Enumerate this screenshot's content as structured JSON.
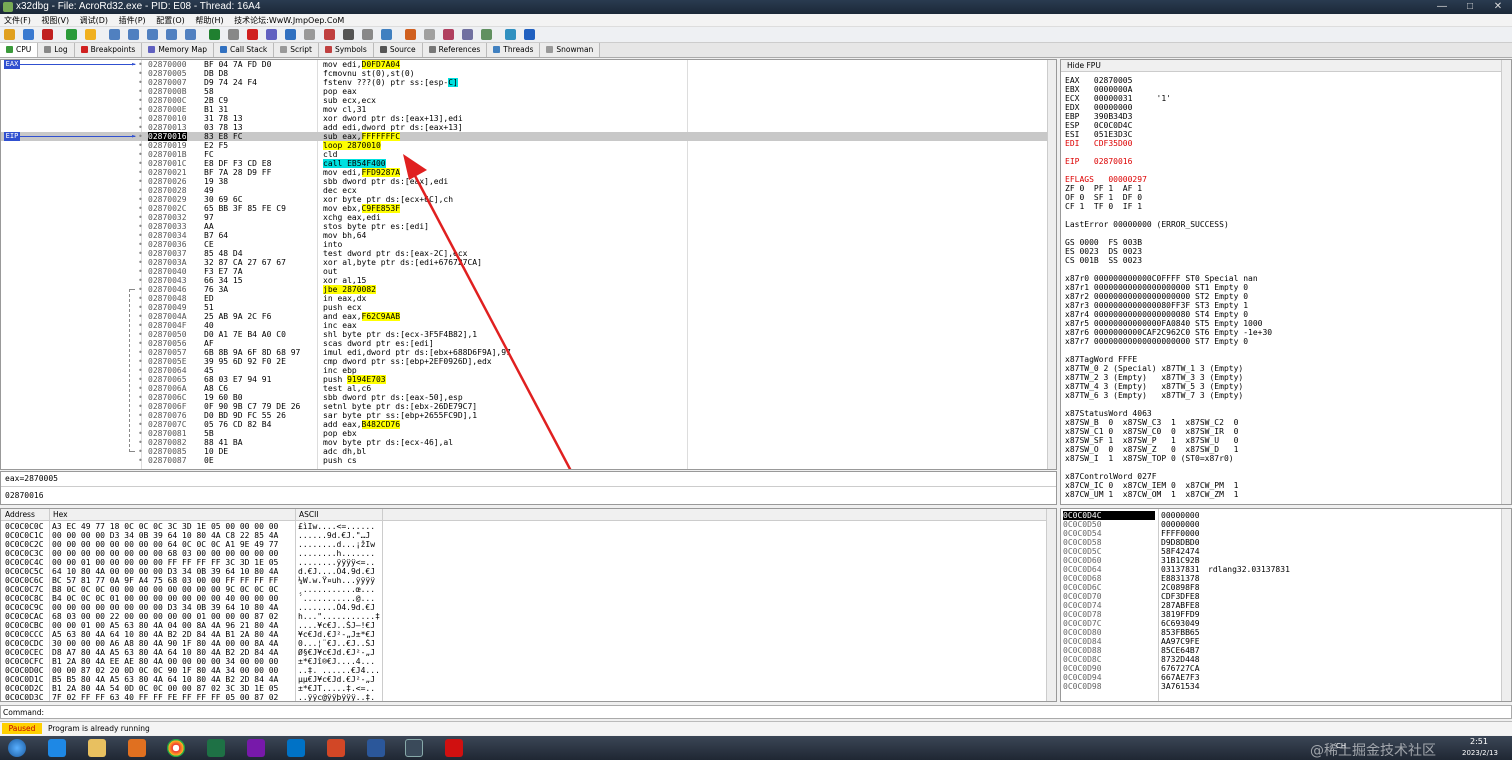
{
  "window": {
    "title": "x32dbg - File: AcroRd32.exe - PID: E08 - Thread: 16A4"
  },
  "menu": [
    "文件(F)",
    "视图(V)",
    "调试(D)",
    "插件(P)",
    "配置(O)",
    "帮助(H)",
    "技术论坛:WwW.JmpOep.CoM"
  ],
  "tabs": [
    {
      "label": "CPU",
      "color": "#3a9a3a"
    },
    {
      "label": "Log",
      "color": "#888"
    },
    {
      "label": "Breakpoints",
      "color": "#d02020"
    },
    {
      "label": "Memory Map",
      "color": "#6060c0"
    },
    {
      "label": "Call Stack",
      "color": "#3070c0"
    },
    {
      "label": "Script",
      "color": "#999"
    },
    {
      "label": "Symbols",
      "color": "#c04040"
    },
    {
      "label": "Source",
      "color": "#555"
    },
    {
      "label": "References",
      "color": "#777"
    },
    {
      "label": "Threads",
      "color": "#4080c0"
    },
    {
      "label": "Snowman",
      "color": "#999"
    }
  ],
  "disasm": {
    "eax_label": "EAX",
    "eip_label": "EIP",
    "rows": [
      {
        "addr": "02870000",
        "bytes": "BF 04 7A FD D0",
        "ins": "mov edi,",
        "op": "D0FD7A04",
        "opc": "hl"
      },
      {
        "addr": "02870005",
        "bytes": "DB D8",
        "ins": "fcmovnu st(0),st(0)"
      },
      {
        "addr": "02870007",
        "bytes": "D9 74 24 F4",
        "ins": "fstenv ???(0) ptr ss:[esp-",
        "op": "C]",
        "opc": "hlc"
      },
      {
        "addr": "0287000B",
        "bytes": "58",
        "ins": "pop eax"
      },
      {
        "addr": "0287000C",
        "bytes": "2B C9",
        "ins": "sub ecx,ecx"
      },
      {
        "addr": "0287000E",
        "bytes": "B1 31",
        "ins": "mov cl,31"
      },
      {
        "addr": "02870010",
        "bytes": "31 78 13",
        "ins": "xor dword ptr ds:[eax+13],edi"
      },
      {
        "addr": "02870013",
        "bytes": "03 78 13",
        "ins": "add edi,dword ptr ds:[eax+13]"
      },
      {
        "addr": "02870016",
        "bytes": "83 E8 FC",
        "ins": "sub eax,",
        "op": "FFFFFFFC",
        "opc": "hl",
        "eip": true
      },
      {
        "addr": "02870019",
        "bytes": "E2 F5",
        "ins": "",
        "op": "loop 2870010",
        "opc": "hl"
      },
      {
        "addr": "0287001B",
        "bytes": "FC",
        "ins": "cld"
      },
      {
        "addr": "0287001C",
        "bytes": "E8 DF F3 CD E8",
        "ins": "",
        "op": "call EB54F400",
        "opc": "hlc"
      },
      {
        "addr": "02870021",
        "bytes": "BF 7A 28 D9 FF",
        "ins": "mov edi,",
        "op": "FFD9287A",
        "opc": "hl"
      },
      {
        "addr": "02870026",
        "bytes": "19 38",
        "ins": "sbb dword ptr ds:[eax],edi"
      },
      {
        "addr": "02870028",
        "bytes": "49",
        "ins": "dec ecx"
      },
      {
        "addr": "02870029",
        "bytes": "30 69 6C",
        "ins": "xor byte ptr ds:[ecx+6C],ch"
      },
      {
        "addr": "0287002C",
        "bytes": "65 BB 3F 85 FE C9",
        "ins": "mov ebx,",
        "op": "C9FE853F",
        "opc": "hl"
      },
      {
        "addr": "02870032",
        "bytes": "97",
        "ins": "xchg eax,edi"
      },
      {
        "addr": "02870033",
        "bytes": "AA",
        "ins": "stos byte ptr es:[edi]"
      },
      {
        "addr": "02870034",
        "bytes": "B7 64",
        "ins": "mov bh,64"
      },
      {
        "addr": "02870036",
        "bytes": "CE",
        "ins": "into"
      },
      {
        "addr": "02870037",
        "bytes": "85 48 D4",
        "ins": "test dword ptr ds:[eax-2C],ecx"
      },
      {
        "addr": "0287003A",
        "bytes": "32 87 CA 27 67 67",
        "ins": "xor al,byte ptr ds:[edi+676727CA]"
      },
      {
        "addr": "02870040",
        "bytes": "F3 E7 7A",
        "ins": "out"
      },
      {
        "addr": "02870043",
        "bytes": "66 34 15",
        "ins": "xor al,15"
      },
      {
        "addr": "02870046",
        "bytes": "76 3A",
        "ins": "",
        "op": "jbe 2870082",
        "opc": "hl"
      },
      {
        "addr": "02870048",
        "bytes": "ED",
        "ins": "in eax,dx"
      },
      {
        "addr": "02870049",
        "bytes": "51",
        "ins": "push ecx"
      },
      {
        "addr": "0287004A",
        "bytes": "25 AB 9A 2C F6",
        "ins": "and eax,",
        "op": "F62C9AAB",
        "opc": "hl"
      },
      {
        "addr": "0287004F",
        "bytes": "40",
        "ins": "inc eax"
      },
      {
        "addr": "02870050",
        "bytes": "D0 A1 7E B4 A0 C0",
        "ins": "shl byte ptr ds:[ecx-3F5F4B82],1"
      },
      {
        "addr": "02870056",
        "bytes": "AF",
        "ins": "scas dword ptr es:[edi]"
      },
      {
        "addr": "02870057",
        "bytes": "6B 8B 9A 6F 8D 68 97",
        "ins": "imul edi,dword ptr ds:[ebx+688D6F9A],97"
      },
      {
        "addr": "0287005E",
        "bytes": "39 95 6D 92 F0 2E",
        "ins": "cmp dword ptr ss:[ebp+2EF0926D],edx"
      },
      {
        "addr": "02870064",
        "bytes": "45",
        "ins": "inc ebp"
      },
      {
        "addr": "02870065",
        "bytes": "68 03 E7 94 91",
        "ins": "push ",
        "op": "9194E703",
        "opc": "hl"
      },
      {
        "addr": "0287006A",
        "bytes": "A8 C6",
        "ins": "test al,c6"
      },
      {
        "addr": "0287006C",
        "bytes": "19 60 B0",
        "ins": "sbb dword ptr ds:[eax-50],esp"
      },
      {
        "addr": "0287006F",
        "bytes": "0F 90 9B C7 79 DE 26",
        "ins": "setnl byte ptr ds:[ebx-26DE79C7]"
      },
      {
        "addr": "02870076",
        "bytes": "D0 BD 9D FC 55 26",
        "ins": "sar byte ptr ss:[ebp+2655FC9D],1"
      },
      {
        "addr": "0287007C",
        "bytes": "05 76 CD 82 B4",
        "ins": "add eax,",
        "op": "B482CD76",
        "opc": "hl"
      },
      {
        "addr": "02870081",
        "bytes": "5B",
        "ins": "pop ebx"
      },
      {
        "addr": "02870082",
        "bytes": "88 41 BA",
        "ins": "mov byte ptr ds:[ecx-46],al"
      },
      {
        "addr": "02870085",
        "bytes": "10 DE",
        "ins": "adc dh,bl"
      },
      {
        "addr": "02870087",
        "bytes": "0E",
        "ins": "push cs"
      }
    ]
  },
  "info": {
    "line1": "eax=2870005",
    "line2": "02870016"
  },
  "registers": {
    "header": "Hide FPU",
    "lines": [
      "EAX   02870005",
      "EBX   0000000A",
      "ECX   00000031     '1'",
      "EDX   00000000",
      "EBP   390B34D3",
      "ESP   0C0C0D4C",
      "ESI   051E3D3C",
      "EDI   CDF35D00",
      "",
      "EIP   02870016",
      "",
      "EFLAGS   00000297",
      "ZF 0  PF 1  AF 1",
      "OF 0  SF 1  DF 0",
      "CF 1  TF 0  IF 1",
      "",
      "LastError 00000000 (ERROR_SUCCESS)",
      "",
      "GS 0000  FS 003B",
      "ES 0023  DS 0023",
      "CS 001B  SS 0023",
      "",
      "x87r0 000000000000C0FFFF ST0 Special nan",
      "x87r1 00000000000000000000 ST1 Empty 0",
      "x87r2 00000000000000000000 ST2 Empty 0",
      "x87r3 0000000000000080FF3F ST3 Empty 1",
      "x87r4 00000000000000000080 ST4 Empty 0",
      "x87r5 00000000000000FA0840 ST5 Empty 1000",
      "x87r6 0000000000CAF2C962C0 ST6 Empty -1e+30",
      "x87r7 00000000000000000000 ST7 Empty 0",
      "",
      "x87TagWord FFFE",
      "x87TW_0 2 (Special) x87TW_1 3 (Empty)",
      "x87TW_2 3 (Empty)   x87TW_3 3 (Empty)",
      "x87TW_4 3 (Empty)   x87TW_5 3 (Empty)",
      "x87TW_6 3 (Empty)   x87TW_7 3 (Empty)",
      "",
      "x87StatusWord 4063",
      "x87SW_B  0  x87SW_C3  1  x87SW_C2  0",
      "x87SW_C1 0  x87SW_C0  0  x87SW_IR  0",
      "x87SW_SF 1  x87SW_P   1  x87SW_U   0",
      "x87SW_O  0  x87SW_Z   0  x87SW_D   1",
      "x87SW_I  1  x87SW_TOP 0 (ST0=x87r0)",
      "",
      "x87ControlWord 027F",
      "x87CW_IC 0  x87CW_IEM 0  x87CW_PM  1",
      "x87CW_UM 1  x87CW_OM  1  x87CW_ZM  1"
    ]
  },
  "dump": {
    "headers": [
      "Address",
      "Hex",
      "ASCII"
    ],
    "rows": [
      {
        "a": "0C0C0C0C",
        "h": "A3 EC 49 77 18 0C 0C 0C 3C 3D 1E 05 00 00 00 00",
        "s": "£ìIw....<=......"
      },
      {
        "a": "0C0C0C1C",
        "h": "00 00 00 00 D3 34 0B 39 64 10 80 4A C8 22 85 4A",
        "s": "......9d.€J.\"…J"
      },
      {
        "a": "0C0C0C2C",
        "h": "00 00 00 00 00 00 00 00 64 0C 0C 0C A1 9E 49 77",
        "s": "........d...¡žIw"
      },
      {
        "a": "0C0C0C3C",
        "h": "00 00 00 00 00 00 00 00 68 03 00 00 00 00 00 00",
        "s": "........h......."
      },
      {
        "a": "0C0C0C4C",
        "h": "00 00 01 00 00 00 00 00 FF FF FF FF 3C 3D 1E 05",
        "s": "........ÿÿÿÿ<=.."
      },
      {
        "a": "0C0C0C5C",
        "h": "64 10 80 4A 00 00 00 00 D3 34 0B 39 64 10 80 4A",
        "s": "d.€J....Ó4.9d.€J"
      },
      {
        "a": "0C0C0C6C",
        "h": "BC 57 81 77 0A 9F A4 75 68 03 00 00 FF FF FF FF",
        "s": "¼W.w.Ÿ¤uh...ÿÿÿÿ"
      },
      {
        "a": "0C0C0C7C",
        "h": "B8 0C 0C 0C 00 00 00 00 00 00 00 00 9C 0C 0C 0C",
        "s": "¸...........œ..."
      },
      {
        "a": "0C0C0C8C",
        "h": "B4 0C 0C 0C 01 00 00 00 00 00 00 00 40 00 00 00",
        "s": "´...........@..."
      },
      {
        "a": "0C0C0C9C",
        "h": "00 00 00 00 00 00 00 00 D3 34 0B 39 64 10 80 4A",
        "s": "........Ó4.9d.€J"
      },
      {
        "a": "0C0C0CAC",
        "h": "68 03 00 00 22 00 00 00 00 00 01 00 00 00 87 02",
        "s": "h...\"...........‡."
      },
      {
        "a": "0C0C0CBC",
        "h": "00 00 01 00 A5 63 80 4A 04 00 8A 4A 96 21 80 4A",
        "s": "....¥c€J..ŠJ–!€J"
      },
      {
        "a": "0C0C0CCC",
        "h": "A5 63 80 4A 64 10 80 4A B2 2D 84 4A B1 2A 80 4A",
        "s": "¥c€Jd.€J²-„J±*€J"
      },
      {
        "a": "0C0C0CDC",
        "h": "30 00 00 00 A6 A8 80 4A 90 1F 80 4A 00 00 8A 4A",
        "s": "0...¦¨€J..€J..ŠJ"
      },
      {
        "a": "0C0C0CEC",
        "h": "D8 A7 80 4A A5 63 80 4A 64 10 80 4A B2 2D 84 4A",
        "s": "Ø§€J¥c€Jd.€J²-„J"
      },
      {
        "a": "0C0C0CFC",
        "h": "B1 2A 80 4A EE AE 80 4A 00 00 00 00 34 00 00 00",
        "s": "±*€Jî®€J....4..."
      },
      {
        "a": "0C0C0D0C",
        "h": "00 00 87 02 20 0D 0C 0C 90 1F 80 4A 34 00 00 00",
        "s": "..‡. ......€J4..."
      },
      {
        "a": "0C0C0D1C",
        "h": "B5 B5 80 4A A5 63 80 4A 64 10 80 4A B2 2D 84 4A",
        "s": "µµ€J¥c€Jd.€J²-„J"
      },
      {
        "a": "0C0C0D2C",
        "h": "B1 2A 80 4A 54 0D 0C 0C 00 00 87 02 3C 3D 1E 05",
        "s": "±*€JT.....‡.<=.."
      },
      {
        "a": "0C0C0D3C",
        "h": "7F 02 FF FF 63 40 FF FF FE FF FF FF 05 00 87 02",
        "s": "..ÿÿc@ÿÿþÿÿÿ..‡."
      }
    ]
  },
  "stack": {
    "rows": [
      {
        "a": "0C0C0D4C",
        "v": "00000000",
        "c": ""
      },
      {
        "a": "0C0C0D50",
        "v": "00000000",
        "c": ""
      },
      {
        "a": "0C0C0D54",
        "v": "FFFF0000",
        "c": ""
      },
      {
        "a": "0C0C0D58",
        "v": "D9D8DBD0",
        "c": ""
      },
      {
        "a": "0C0C0D5C",
        "v": "58F42474",
        "c": ""
      },
      {
        "a": "0C0C0D60",
        "v": "31B1C92B",
        "c": ""
      },
      {
        "a": "0C0C0D64",
        "v": "03137831",
        "c": "rdlang32.03137831"
      },
      {
        "a": "0C0C0D68",
        "v": "E8831378",
        "c": ""
      },
      {
        "a": "0C0C0D6C",
        "v": "2C0898F8",
        "c": ""
      },
      {
        "a": "0C0C0D70",
        "v": "CDF3DFE8",
        "c": ""
      },
      {
        "a": "0C0C0D74",
        "v": "287ABFE8",
        "c": ""
      },
      {
        "a": "0C0C0D78",
        "v": "3819FFD9",
        "c": ""
      },
      {
        "a": "0C0C0D7C",
        "v": "6C693049",
        "c": ""
      },
      {
        "a": "0C0C0D80",
        "v": "853FBB65",
        "c": ""
      },
      {
        "a": "0C0C0D84",
        "v": "AA97C9FE",
        "c": ""
      },
      {
        "a": "0C0C0D88",
        "v": "85CE64B7",
        "c": ""
      },
      {
        "a": "0C0C0D8C",
        "v": "8732D448",
        "c": ""
      },
      {
        "a": "0C0C0D90",
        "v": "676727CA",
        "c": ""
      },
      {
        "a": "0C0C0D94",
        "v": "667AE7F3",
        "c": ""
      },
      {
        "a": "0C0C0D98",
        "v": "3A761534",
        "c": ""
      }
    ]
  },
  "command": {
    "label": "Command:"
  },
  "status": {
    "state": "Paused",
    "message": "Program is already running"
  },
  "taskbar": {
    "time": "2:51",
    "date": "2023/2/13",
    "lang": "CH",
    "watermark": "@稀土掘金技术社区"
  }
}
